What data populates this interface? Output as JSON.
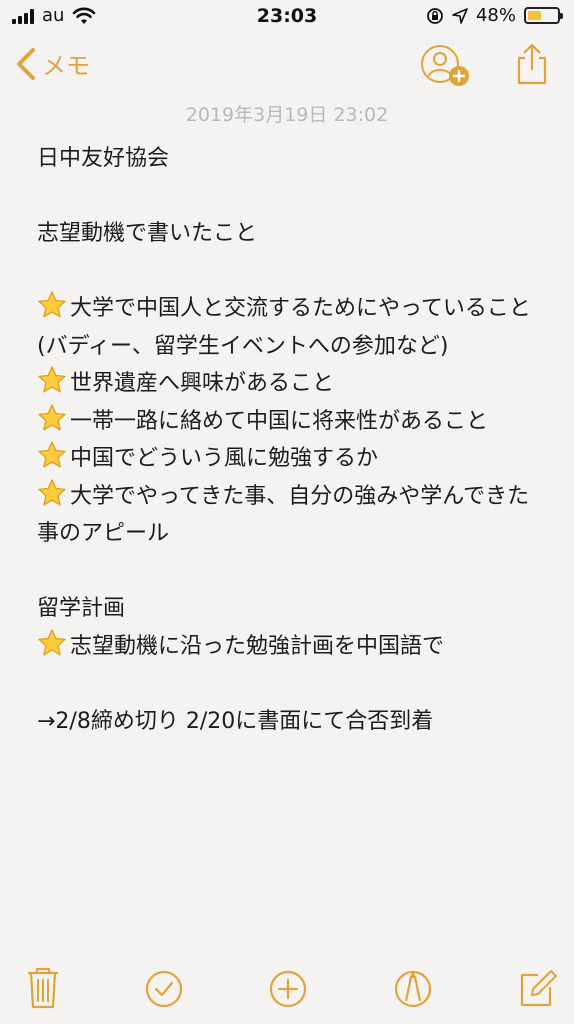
{
  "status_bar": {
    "carrier": "au",
    "time": "23:03",
    "battery_percent": "48%",
    "battery_level": 0.48,
    "icons": [
      "signal-icon",
      "wifi-icon",
      "rotation-lock-icon",
      "location-icon",
      "battery-icon"
    ]
  },
  "nav": {
    "back_label": "メモ",
    "icons": [
      "chevron-left-icon",
      "add-person-icon",
      "share-icon"
    ]
  },
  "note": {
    "date": "2019年3月19日 23:02",
    "lines": [
      {
        "star": false,
        "text": "日中友好協会"
      },
      {
        "star": false,
        "text": ""
      },
      {
        "star": false,
        "text": "志望動機で書いたこと"
      },
      {
        "star": false,
        "text": ""
      },
      {
        "star": true,
        "text": "大学で中国人と交流するためにやっていること(バディー、留学生イベントへの参加など)"
      },
      {
        "star": true,
        "text": "世界遺産へ興味があること"
      },
      {
        "star": true,
        "text": "一帯一路に絡めて中国に将来性があること"
      },
      {
        "star": true,
        "text": "中国でどういう風に勉強するか"
      },
      {
        "star": true,
        "text": "大学でやってきた事、自分の強みや学んできた事のアピール"
      },
      {
        "star": false,
        "text": ""
      },
      {
        "star": false,
        "text": "留学計画"
      },
      {
        "star": true,
        "text": "志望動機に沿った勉強計画を中国語で"
      },
      {
        "star": false,
        "text": ""
      },
      {
        "star": false,
        "text": "→2/8締め切り 2/20に書面にて合否到着"
      }
    ]
  },
  "toolbar": {
    "icons": [
      "trash-icon",
      "checklist-icon",
      "add-icon",
      "markup-icon",
      "compose-icon"
    ]
  },
  "colors": {
    "accent": "#dfa43a",
    "background": "#f4f3f1",
    "date_text": "#b8b8b8",
    "text": "#1c1c1c",
    "battery_fill": "#f3c43a"
  }
}
